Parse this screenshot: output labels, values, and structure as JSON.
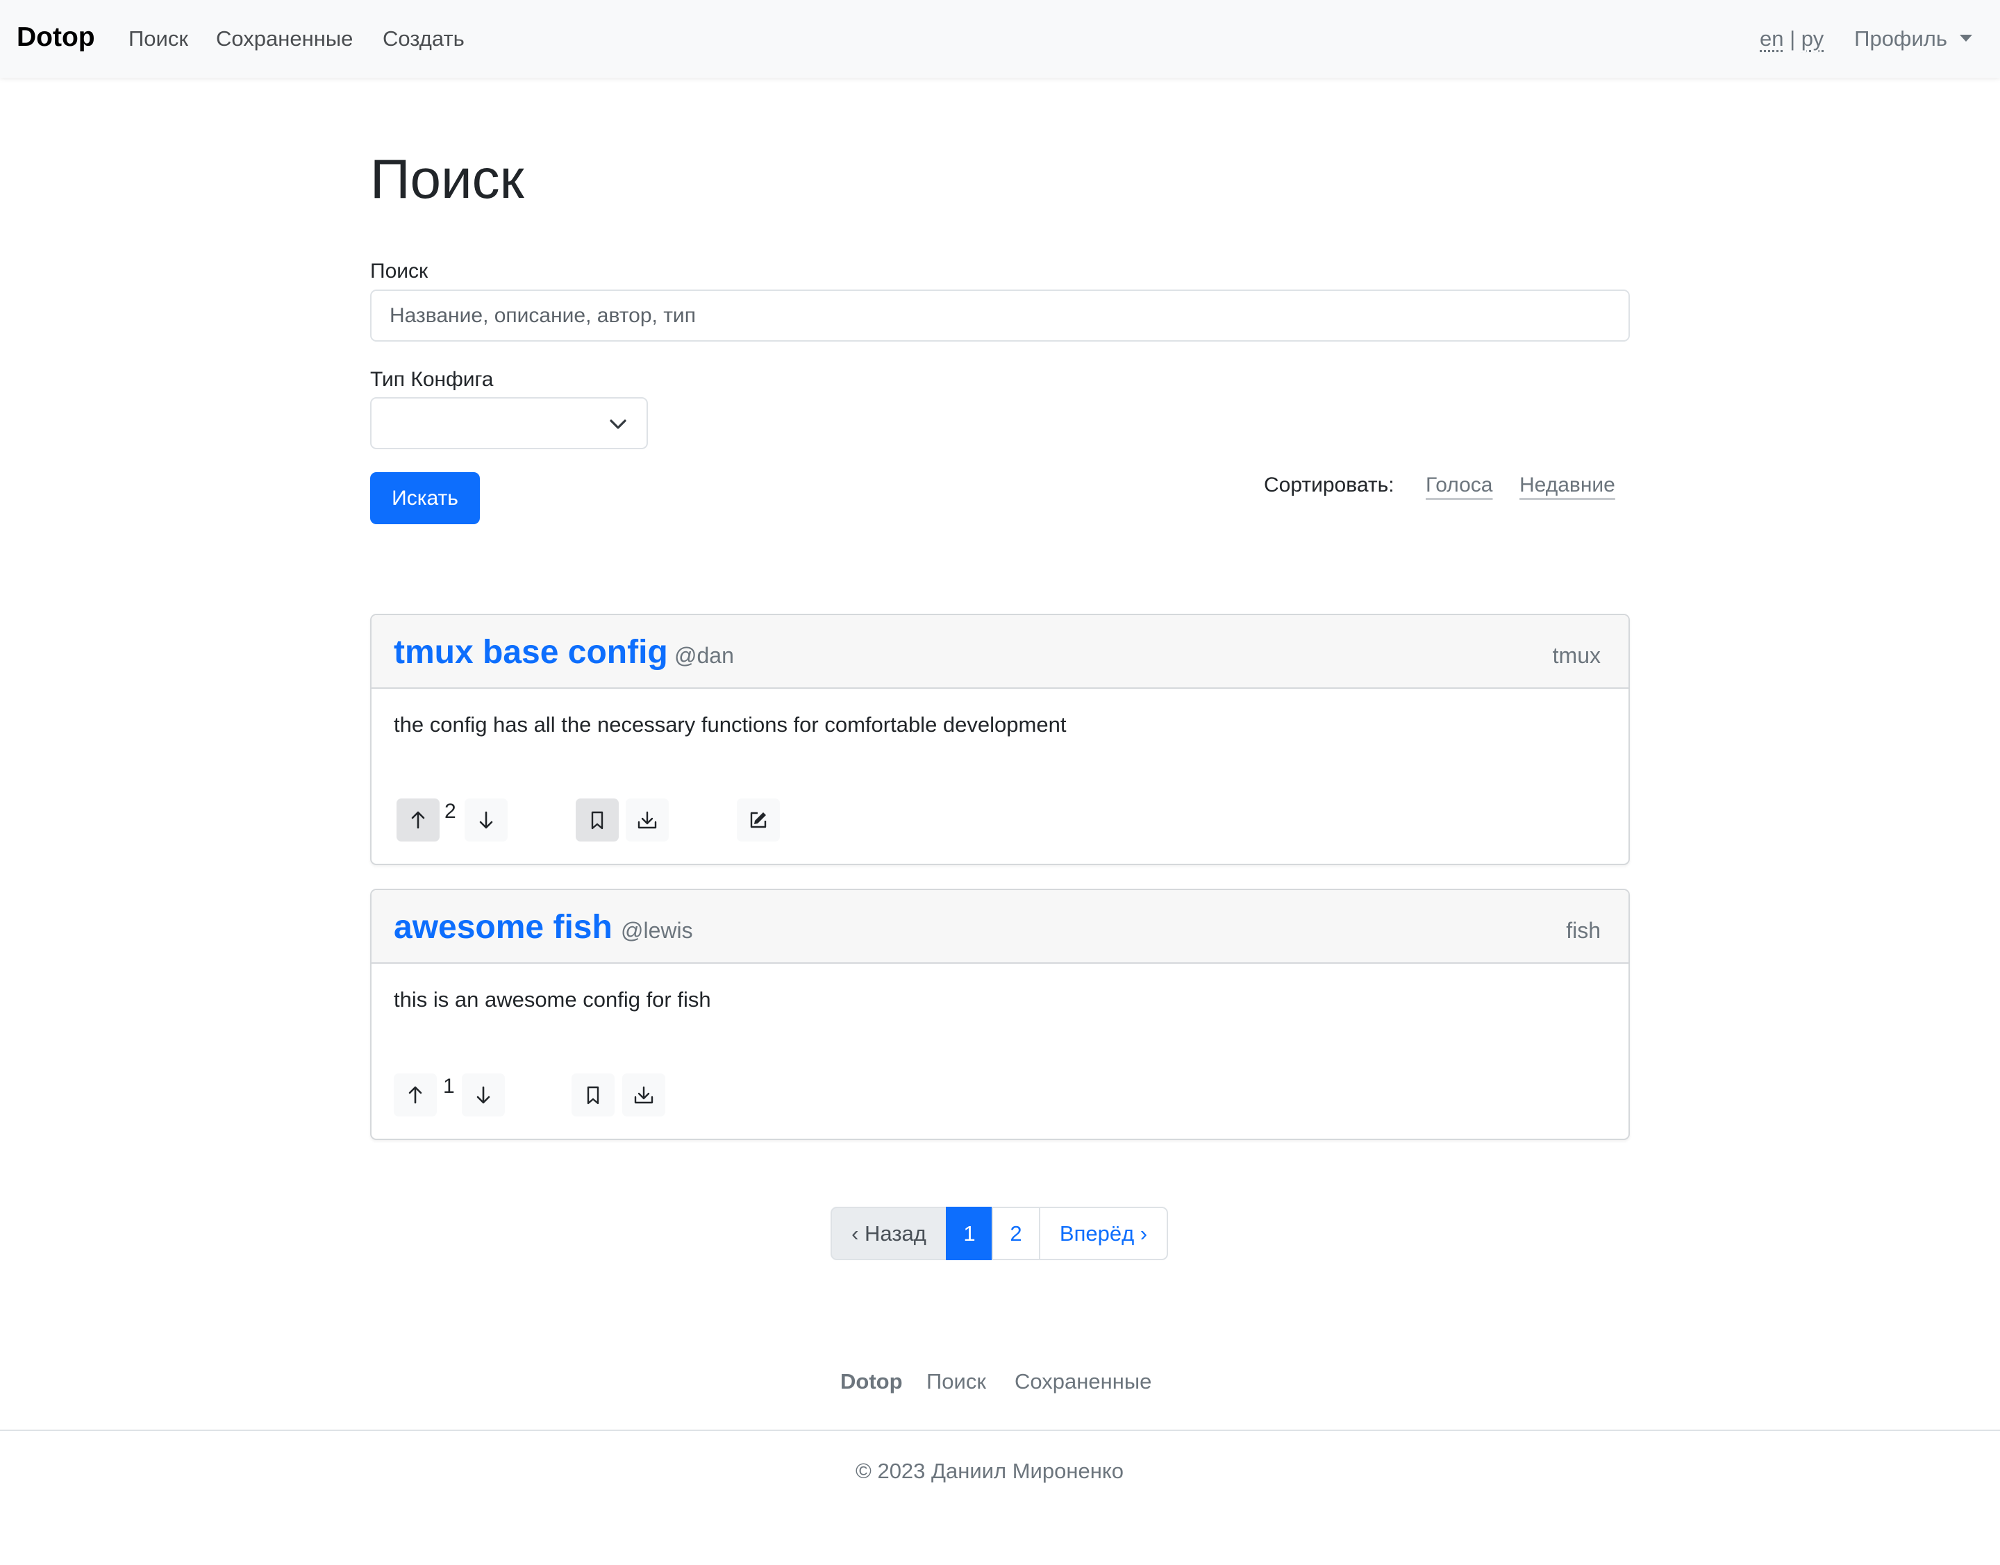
{
  "navbar": {
    "brand": "Dotop",
    "links": [
      "Поиск",
      "Сохраненные",
      "Создать"
    ],
    "lang_en": "en",
    "lang_sep": "|",
    "lang_ru": "ру",
    "profile": "Профиль"
  },
  "search": {
    "title": "Поиск",
    "label": "Поиск",
    "placeholder": "Название, описание, автор, тип",
    "type_label": "Тип Конфига",
    "type_value": "",
    "submit": "Искать",
    "sort_label": "Сортировать:",
    "sort_votes": "Голоса",
    "sort_recent": "Недавние"
  },
  "results": [
    {
      "title": "tmux base config",
      "author": "@dan",
      "type": "tmux",
      "description": "the config has all the necessary functions for comfortable development",
      "votes": "2",
      "editable": true
    },
    {
      "title": "awesome fish",
      "author": "@lewis",
      "type": "fish",
      "description": "this is an awesome config for fish",
      "votes": "1",
      "editable": false
    }
  ],
  "pagination": {
    "prev": "‹ Назад",
    "pages": [
      "1",
      "2"
    ],
    "current": "1",
    "next": "Вперёд ›"
  },
  "footer": {
    "brand": "Dotop",
    "links": [
      "Поиск",
      "Сохраненные"
    ],
    "copyright": "© 2023 Даниил Мироненко"
  },
  "colors": {
    "primary": "#0d6efd",
    "navbar_bg": "#f8f9fa",
    "muted": "#6c757d"
  },
  "icons": [
    "arrow-up-icon",
    "arrow-down-icon",
    "bookmark-icon",
    "download-icon",
    "edit-icon",
    "chevron-down-icon",
    "caret-down-icon"
  ]
}
